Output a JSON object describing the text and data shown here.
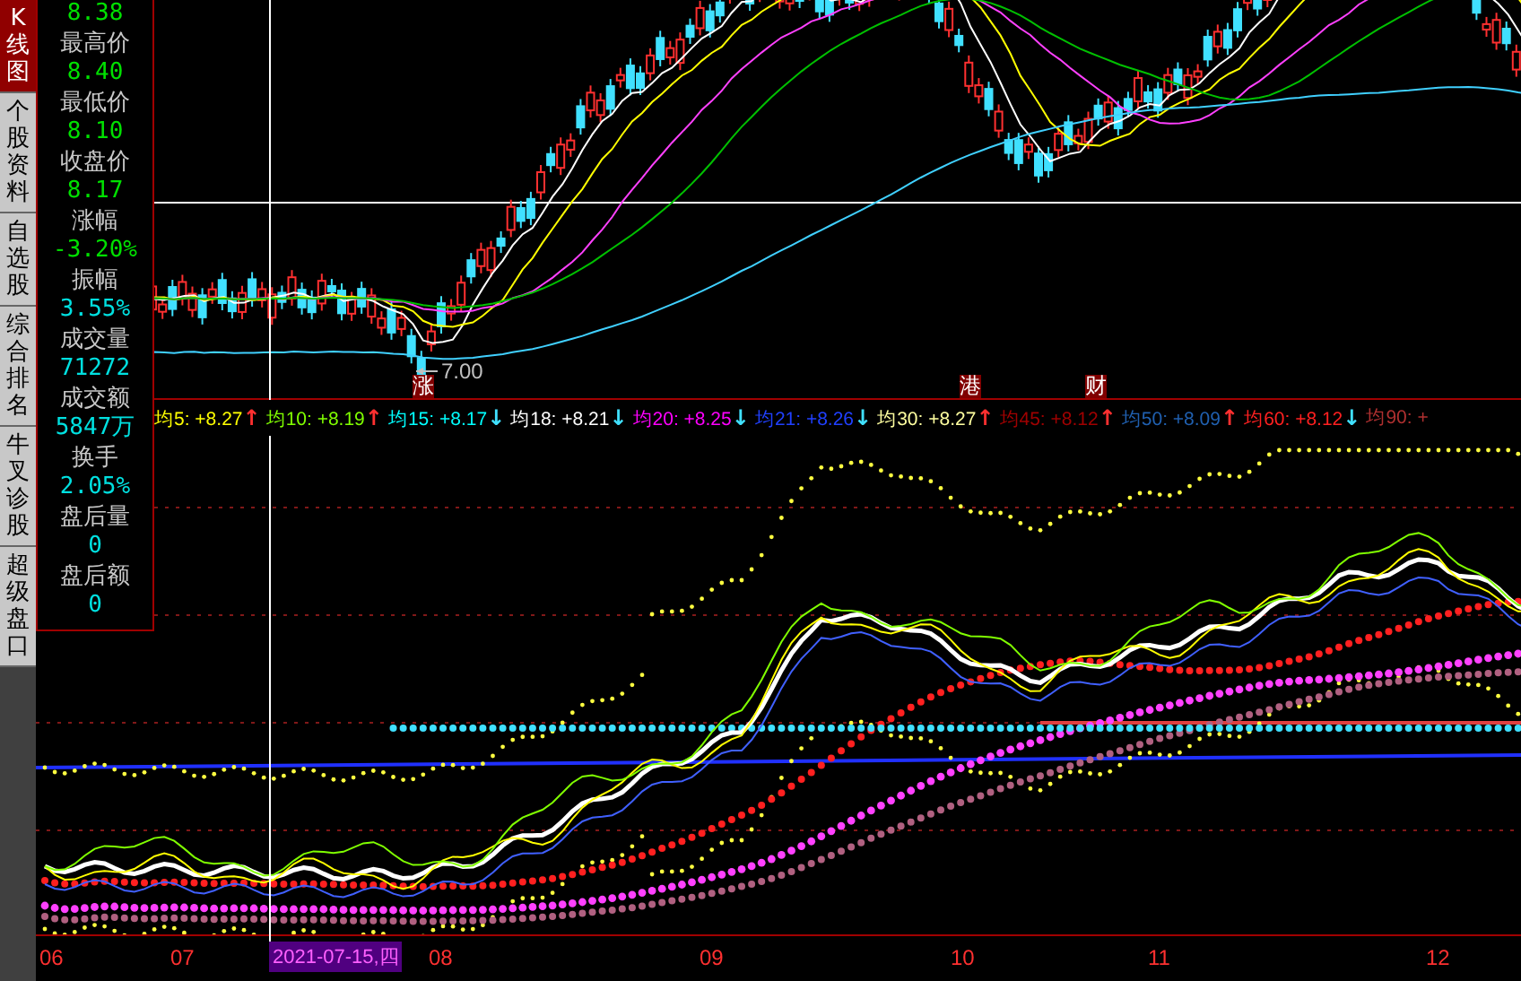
{
  "side_tabs": [
    {
      "label": "K线图",
      "selected": true
    },
    {
      "label": "个股资料",
      "selected": false
    },
    {
      "label": "自选股",
      "selected": false
    },
    {
      "label": "综合排名",
      "selected": false
    },
    {
      "label": "牛叉诊股",
      "selected": false
    },
    {
      "label": "超级盘口",
      "selected": false
    }
  ],
  "info_panel": {
    "rows": [
      {
        "value": "8.38",
        "color": "#00e000"
      },
      {
        "label": "最高价",
        "value": "8.40",
        "color": "#00e000"
      },
      {
        "label": "最低价",
        "value": "8.10",
        "color": "#00e000"
      },
      {
        "label": "收盘价",
        "value": "8.17",
        "color": "#00e000"
      },
      {
        "label": "涨幅",
        "value": "-3.20%",
        "color": "#00e000"
      },
      {
        "label": "振幅",
        "value": "3.55%",
        "color": "#00e0e0"
      },
      {
        "label": "成交量",
        "value": "71272",
        "color": "#00e0e0"
      },
      {
        "label": "成交额",
        "value": "5847万",
        "color": "#00e0e0"
      },
      {
        "label": "换手",
        "value": "2.05%",
        "color": "#00e0e0"
      },
      {
        "label": "盘后量",
        "value": "0",
        "color": "#00e0e0"
      },
      {
        "label": "盘后额",
        "value": "0",
        "color": "#00e0e0"
      }
    ]
  },
  "price_chart": {
    "low_marker": "7.00",
    "event_markers": [
      {
        "label": "涨"
      },
      {
        "label": "港"
      },
      {
        "label": "财"
      }
    ]
  },
  "ma_legend": [
    {
      "label": "均5: +8.27",
      "arrow": {
        "text": "↑",
        "color": "#ff3030"
      },
      "color": "#ffff00"
    },
    {
      "label": "均10: +8.19",
      "arrow": {
        "text": "↑",
        "color": "#ff3030"
      },
      "color": "#80ff00"
    },
    {
      "label": "均15: +8.17",
      "arrow": {
        "text": "↓",
        "color": "#40e0ff"
      },
      "color": "#00ffff"
    },
    {
      "label": "均18: +8.21",
      "arrow": {
        "text": "↓",
        "color": "#40e0ff"
      },
      "color": "#ffffff"
    },
    {
      "label": "均20: +8.25",
      "arrow": {
        "text": "↓",
        "color": "#40e0ff"
      },
      "color": "#ff00ff"
    },
    {
      "label": "均21: +8.26",
      "arrow": {
        "text": "↓",
        "color": "#40e0ff"
      },
      "color": "#2040ff"
    },
    {
      "label": "均30: +8.27",
      "arrow": {
        "text": "↑",
        "color": "#ff3030"
      },
      "color": "#ffffa0"
    },
    {
      "label": "均45: +8.12",
      "arrow": {
        "text": "↑",
        "color": "#ff3030"
      },
      "color": "#a00000"
    },
    {
      "label": "均50: +8.09",
      "arrow": {
        "text": "↑",
        "color": "#ff3030"
      },
      "color": "#2060b0"
    },
    {
      "label": "均60: +8.12",
      "arrow": {
        "text": "↓",
        "color": "#40e0ff"
      },
      "color": "#ff2020"
    },
    {
      "label": "均90: +",
      "color": "#b03030"
    }
  ],
  "x_axis": {
    "labels": [
      "06",
      "07",
      "08",
      "09",
      "10",
      "11",
      "12"
    ],
    "cursor_date": "2021-07-15,四"
  }
}
